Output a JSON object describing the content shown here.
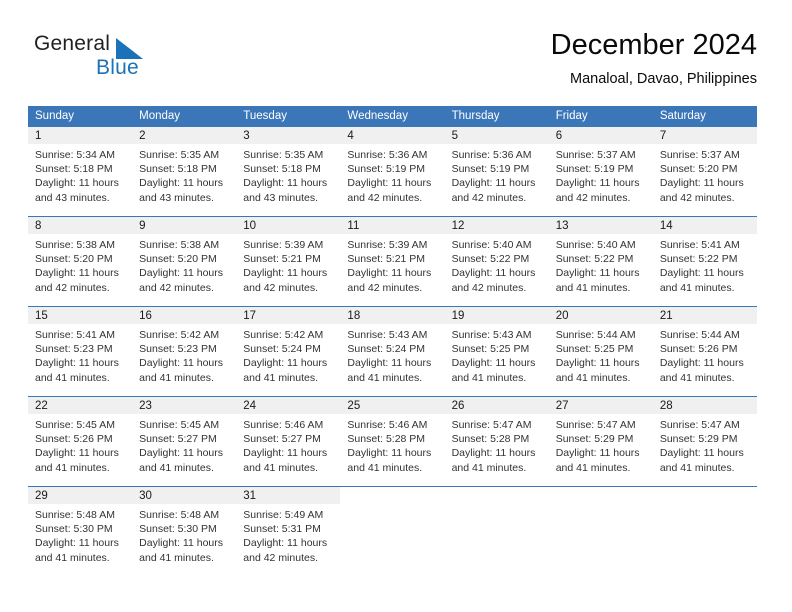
{
  "brand": {
    "name_top": "General",
    "name_bottom": "Blue",
    "color_blue": "#1b72b8",
    "color_dark": "#231f20",
    "triangle_icon": "triangle-icon"
  },
  "header": {
    "title": "December 2024",
    "subtitle": "Manaloal, Davao, Philippines"
  },
  "theme": {
    "header_row_background": "#3b77b8",
    "header_row_text": "#ffffff",
    "daynumber_band_background": "#f0f0f0",
    "grid_line": "#3b77b8",
    "body_text": "#333333"
  },
  "calendar": {
    "columns": [
      "Sunday",
      "Monday",
      "Tuesday",
      "Wednesday",
      "Thursday",
      "Friday",
      "Saturday"
    ],
    "weeks": [
      [
        {
          "day": "1",
          "sunrise": "Sunrise: 5:34 AM",
          "sunset": "Sunset: 5:18 PM",
          "daylight1": "Daylight: 11 hours",
          "daylight2": "and 43 minutes."
        },
        {
          "day": "2",
          "sunrise": "Sunrise: 5:35 AM",
          "sunset": "Sunset: 5:18 PM",
          "daylight1": "Daylight: 11 hours",
          "daylight2": "and 43 minutes."
        },
        {
          "day": "3",
          "sunrise": "Sunrise: 5:35 AM",
          "sunset": "Sunset: 5:18 PM",
          "daylight1": "Daylight: 11 hours",
          "daylight2": "and 43 minutes."
        },
        {
          "day": "4",
          "sunrise": "Sunrise: 5:36 AM",
          "sunset": "Sunset: 5:19 PM",
          "daylight1": "Daylight: 11 hours",
          "daylight2": "and 42 minutes."
        },
        {
          "day": "5",
          "sunrise": "Sunrise: 5:36 AM",
          "sunset": "Sunset: 5:19 PM",
          "daylight1": "Daylight: 11 hours",
          "daylight2": "and 42 minutes."
        },
        {
          "day": "6",
          "sunrise": "Sunrise: 5:37 AM",
          "sunset": "Sunset: 5:19 PM",
          "daylight1": "Daylight: 11 hours",
          "daylight2": "and 42 minutes."
        },
        {
          "day": "7",
          "sunrise": "Sunrise: 5:37 AM",
          "sunset": "Sunset: 5:20 PM",
          "daylight1": "Daylight: 11 hours",
          "daylight2": "and 42 minutes."
        }
      ],
      [
        {
          "day": "8",
          "sunrise": "Sunrise: 5:38 AM",
          "sunset": "Sunset: 5:20 PM",
          "daylight1": "Daylight: 11 hours",
          "daylight2": "and 42 minutes."
        },
        {
          "day": "9",
          "sunrise": "Sunrise: 5:38 AM",
          "sunset": "Sunset: 5:20 PM",
          "daylight1": "Daylight: 11 hours",
          "daylight2": "and 42 minutes."
        },
        {
          "day": "10",
          "sunrise": "Sunrise: 5:39 AM",
          "sunset": "Sunset: 5:21 PM",
          "daylight1": "Daylight: 11 hours",
          "daylight2": "and 42 minutes."
        },
        {
          "day": "11",
          "sunrise": "Sunrise: 5:39 AM",
          "sunset": "Sunset: 5:21 PM",
          "daylight1": "Daylight: 11 hours",
          "daylight2": "and 42 minutes."
        },
        {
          "day": "12",
          "sunrise": "Sunrise: 5:40 AM",
          "sunset": "Sunset: 5:22 PM",
          "daylight1": "Daylight: 11 hours",
          "daylight2": "and 42 minutes."
        },
        {
          "day": "13",
          "sunrise": "Sunrise: 5:40 AM",
          "sunset": "Sunset: 5:22 PM",
          "daylight1": "Daylight: 11 hours",
          "daylight2": "and 41 minutes."
        },
        {
          "day": "14",
          "sunrise": "Sunrise: 5:41 AM",
          "sunset": "Sunset: 5:22 PM",
          "daylight1": "Daylight: 11 hours",
          "daylight2": "and 41 minutes."
        }
      ],
      [
        {
          "day": "15",
          "sunrise": "Sunrise: 5:41 AM",
          "sunset": "Sunset: 5:23 PM",
          "daylight1": "Daylight: 11 hours",
          "daylight2": "and 41 minutes."
        },
        {
          "day": "16",
          "sunrise": "Sunrise: 5:42 AM",
          "sunset": "Sunset: 5:23 PM",
          "daylight1": "Daylight: 11 hours",
          "daylight2": "and 41 minutes."
        },
        {
          "day": "17",
          "sunrise": "Sunrise: 5:42 AM",
          "sunset": "Sunset: 5:24 PM",
          "daylight1": "Daylight: 11 hours",
          "daylight2": "and 41 minutes."
        },
        {
          "day": "18",
          "sunrise": "Sunrise: 5:43 AM",
          "sunset": "Sunset: 5:24 PM",
          "daylight1": "Daylight: 11 hours",
          "daylight2": "and 41 minutes."
        },
        {
          "day": "19",
          "sunrise": "Sunrise: 5:43 AM",
          "sunset": "Sunset: 5:25 PM",
          "daylight1": "Daylight: 11 hours",
          "daylight2": "and 41 minutes."
        },
        {
          "day": "20",
          "sunrise": "Sunrise: 5:44 AM",
          "sunset": "Sunset: 5:25 PM",
          "daylight1": "Daylight: 11 hours",
          "daylight2": "and 41 minutes."
        },
        {
          "day": "21",
          "sunrise": "Sunrise: 5:44 AM",
          "sunset": "Sunset: 5:26 PM",
          "daylight1": "Daylight: 11 hours",
          "daylight2": "and 41 minutes."
        }
      ],
      [
        {
          "day": "22",
          "sunrise": "Sunrise: 5:45 AM",
          "sunset": "Sunset: 5:26 PM",
          "daylight1": "Daylight: 11 hours",
          "daylight2": "and 41 minutes."
        },
        {
          "day": "23",
          "sunrise": "Sunrise: 5:45 AM",
          "sunset": "Sunset: 5:27 PM",
          "daylight1": "Daylight: 11 hours",
          "daylight2": "and 41 minutes."
        },
        {
          "day": "24",
          "sunrise": "Sunrise: 5:46 AM",
          "sunset": "Sunset: 5:27 PM",
          "daylight1": "Daylight: 11 hours",
          "daylight2": "and 41 minutes."
        },
        {
          "day": "25",
          "sunrise": "Sunrise: 5:46 AM",
          "sunset": "Sunset: 5:28 PM",
          "daylight1": "Daylight: 11 hours",
          "daylight2": "and 41 minutes."
        },
        {
          "day": "26",
          "sunrise": "Sunrise: 5:47 AM",
          "sunset": "Sunset: 5:28 PM",
          "daylight1": "Daylight: 11 hours",
          "daylight2": "and 41 minutes."
        },
        {
          "day": "27",
          "sunrise": "Sunrise: 5:47 AM",
          "sunset": "Sunset: 5:29 PM",
          "daylight1": "Daylight: 11 hours",
          "daylight2": "and 41 minutes."
        },
        {
          "day": "28",
          "sunrise": "Sunrise: 5:47 AM",
          "sunset": "Sunset: 5:29 PM",
          "daylight1": "Daylight: 11 hours",
          "daylight2": "and 41 minutes."
        }
      ],
      [
        {
          "day": "29",
          "sunrise": "Sunrise: 5:48 AM",
          "sunset": "Sunset: 5:30 PM",
          "daylight1": "Daylight: 11 hours",
          "daylight2": "and 41 minutes."
        },
        {
          "day": "30",
          "sunrise": "Sunrise: 5:48 AM",
          "sunset": "Sunset: 5:30 PM",
          "daylight1": "Daylight: 11 hours",
          "daylight2": "and 41 minutes."
        },
        {
          "day": "31",
          "sunrise": "Sunrise: 5:49 AM",
          "sunset": "Sunset: 5:31 PM",
          "daylight1": "Daylight: 11 hours",
          "daylight2": "and 42 minutes."
        },
        {
          "day": "",
          "sunrise": "",
          "sunset": "",
          "daylight1": "",
          "daylight2": ""
        },
        {
          "day": "",
          "sunrise": "",
          "sunset": "",
          "daylight1": "",
          "daylight2": ""
        },
        {
          "day": "",
          "sunrise": "",
          "sunset": "",
          "daylight1": "",
          "daylight2": ""
        },
        {
          "day": "",
          "sunrise": "",
          "sunset": "",
          "daylight1": "",
          "daylight2": ""
        }
      ]
    ]
  }
}
